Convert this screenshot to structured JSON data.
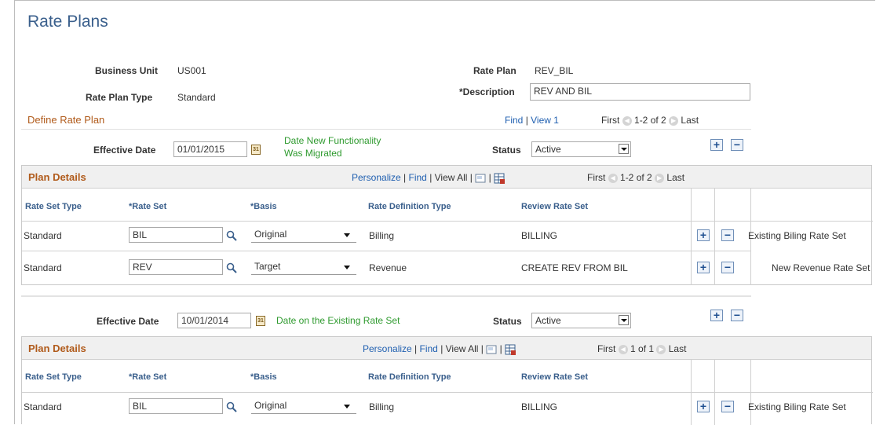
{
  "page": {
    "title": "Rate Plans"
  },
  "header": {
    "business_unit_label": "Business Unit",
    "business_unit_value": "US001",
    "rate_plan_label": "Rate Plan",
    "rate_plan_value": "REV_BIL",
    "rate_plan_type_label": "Rate Plan Type",
    "rate_plan_type_value": "Standard",
    "description_label": "*Description",
    "description_value": "REV AND BIL"
  },
  "define": {
    "title": "Define Rate Plan",
    "find": "Find",
    "view": "View 1",
    "first": "First",
    "range": "1-2 of 2",
    "last": "Last"
  },
  "rows": [
    {
      "effective_date_label": "Effective Date",
      "effective_date": "01/01/2015",
      "note_line1": "Date New Functionality",
      "note_line2": "Was Migrated",
      "status_label": "Status",
      "status": "Active",
      "grid": {
        "title": "Plan Details",
        "personalize": "Personalize",
        "find": "Find",
        "view_all": "View All",
        "first": "First",
        "range": "1-2 of 2",
        "last": "Last",
        "columns": [
          "Rate Set Type",
          "*Rate Set",
          "*Basis",
          "Rate Definition Type",
          "Review Rate Set"
        ],
        "rows": [
          {
            "type": "Standard",
            "rate_set": "BIL",
            "basis": "Original",
            "definition": "Billing",
            "review": "BILLING",
            "note": "Existing Biling Rate Set"
          },
          {
            "type": "Standard",
            "rate_set": "REV",
            "basis": "Target",
            "definition": "Revenue",
            "review": "CREATE REV FROM BIL",
            "note": "New Revenue Rate Set"
          }
        ]
      }
    },
    {
      "effective_date_label": "Effective Date",
      "effective_date": "10/01/2014",
      "note_line1": "Date on the Existing Rate Set",
      "status_label": "Status",
      "status": "Active",
      "grid": {
        "title": "Plan Details",
        "personalize": "Personalize",
        "find": "Find",
        "view_all": "View All",
        "first": "First",
        "range": "1 of 1",
        "last": "Last",
        "columns": [
          "Rate Set Type",
          "*Rate Set",
          "*Basis",
          "Rate Definition Type",
          "Review Rate Set"
        ],
        "rows": [
          {
            "type": "Standard",
            "rate_set": "BIL",
            "basis": "Original",
            "definition": "Billing",
            "review": "BILLING",
            "note": "Existing Biling Rate Set"
          }
        ]
      }
    }
  ],
  "icons": {
    "calendar": "calendar-icon",
    "lookup": "magnifier-icon",
    "add": "plus-icon",
    "delete": "minus-icon",
    "zoom": "zoom-grid-icon",
    "download": "download-excel-icon",
    "prev": "prev-arrow-icon",
    "next": "next-arrow-icon"
  },
  "colors": {
    "title": "#3a5f8c",
    "link": "#1f5fb0",
    "note": "#2e9a2e",
    "section": "#b05a1a"
  }
}
